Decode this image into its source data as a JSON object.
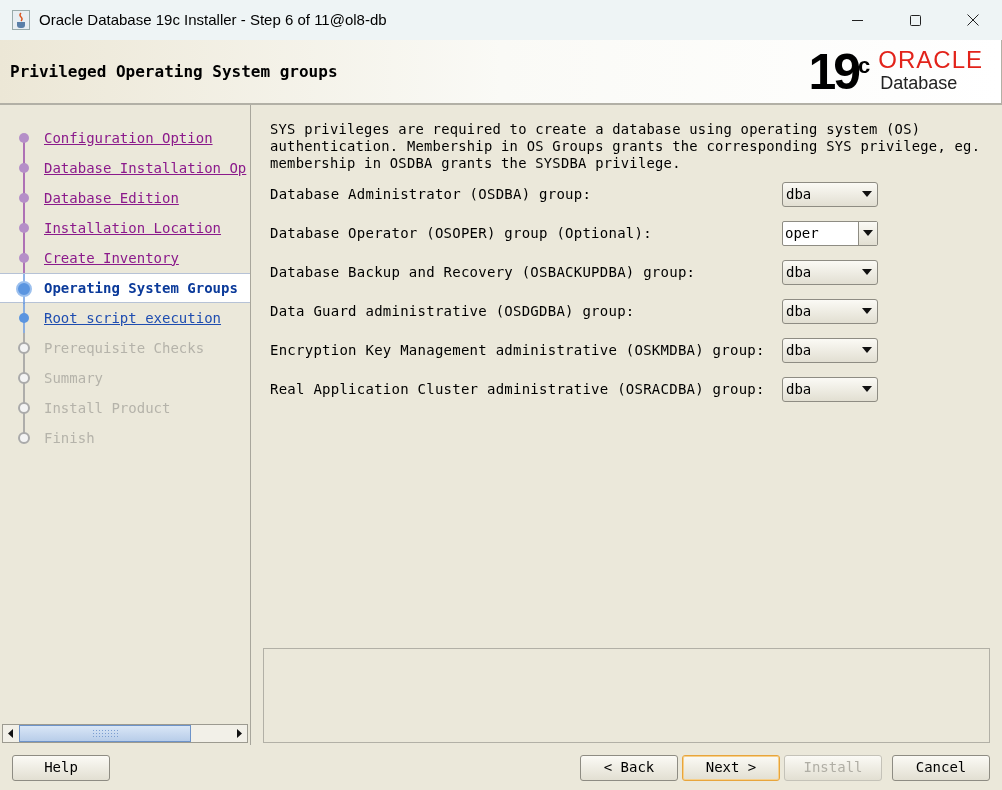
{
  "window": {
    "title": "Oracle Database 19c Installer - Step 6 of 11@ol8-db"
  },
  "header": {
    "title": "Privileged Operating System groups",
    "logo": {
      "version": "19",
      "suffix": "c",
      "brand": "ORACLE",
      "product": "Database"
    }
  },
  "steps": [
    {
      "label": "Configuration Option",
      "kind": "done",
      "selected": false
    },
    {
      "label": "Database Installation Op",
      "kind": "done",
      "selected": false
    },
    {
      "label": "Database Edition",
      "kind": "done",
      "selected": false
    },
    {
      "label": "Installation Location",
      "kind": "done",
      "selected": false
    },
    {
      "label": "Create Inventory",
      "kind": "done",
      "selected": false
    },
    {
      "label": "Operating System Groups",
      "kind": "current",
      "selected": true
    },
    {
      "label": "Root script execution",
      "kind": "next",
      "selected": false
    },
    {
      "label": "Prerequisite Checks",
      "kind": "pending",
      "selected": false
    },
    {
      "label": "Summary",
      "kind": "pending",
      "selected": false
    },
    {
      "label": "Install Product",
      "kind": "pending",
      "selected": false
    },
    {
      "label": "Finish",
      "kind": "pending",
      "selected": false
    }
  ],
  "intro": "SYS privileges are required to create a database using operating system (OS) authentication. Membership in OS Groups grants the corresponding SYS privilege, eg. membership in OSDBA grants the SYSDBA privilege.",
  "groups": [
    {
      "label": "Database Administrator (OSDBA) group:",
      "value": "dba",
      "kind": "select"
    },
    {
      "label": "Database Operator (OSOPER) group (Optional):",
      "value": "oper",
      "kind": "combo"
    },
    {
      "label": "Database Backup and Recovery (OSBACKUPDBA) group:",
      "value": "dba",
      "kind": "select"
    },
    {
      "label": "Data Guard administrative (OSDGDBA) group:",
      "value": "dba",
      "kind": "select"
    },
    {
      "label": "Encryption Key Management administrative (OSKMDBA) group:",
      "value": "dba",
      "kind": "select"
    },
    {
      "label": "Real Application Cluster administrative (OSRACDBA) group:",
      "value": "dba",
      "kind": "select"
    }
  ],
  "buttons": [
    {
      "label": "Help",
      "disabled": false,
      "focused": false,
      "kind": "left"
    },
    {
      "label": "< Back",
      "disabled": false,
      "focused": false,
      "kind": "right"
    },
    {
      "label": "Next >",
      "disabled": false,
      "focused": true,
      "kind": "right"
    },
    {
      "label": "Install",
      "disabled": true,
      "focused": false,
      "kind": "right"
    },
    {
      "label": "Cancel",
      "disabled": false,
      "focused": false,
      "kind": "right"
    }
  ]
}
